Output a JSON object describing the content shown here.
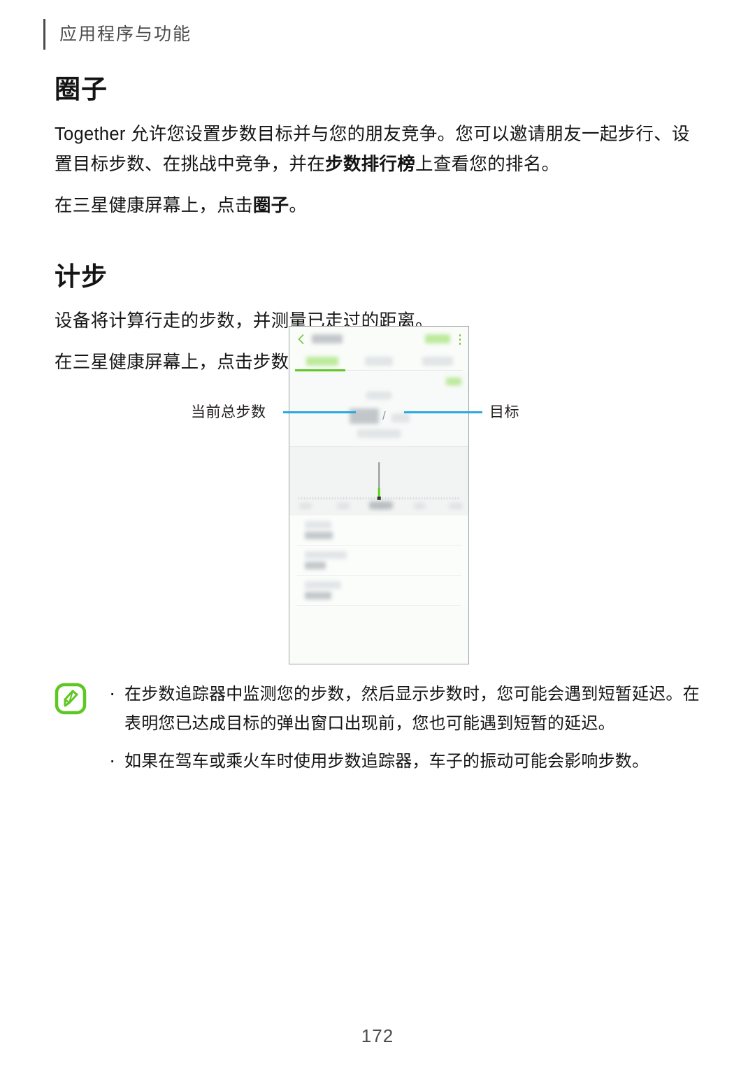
{
  "header": {
    "breadcrumb": "应用程序与功能"
  },
  "sections": [
    {
      "title": "圈子",
      "paragraphs": [
        {
          "parts": [
            {
              "text": "Together 允许您设置步数目标并与您的朋友竞争。您可以邀请朋友一起步行、设置目标步数、在挑战中竞争，并在",
              "bold": false
            },
            {
              "text": "步数排行榜",
              "bold": true
            },
            {
              "text": "上查看您的排名。",
              "bold": false
            }
          ]
        },
        {
          "parts": [
            {
              "text": "在三星健康屏幕上，点击",
              "bold": false
            },
            {
              "text": "圈子",
              "bold": true
            },
            {
              "text": "。",
              "bold": false
            }
          ]
        }
      ]
    },
    {
      "title": "计步",
      "paragraphs": [
        {
          "parts": [
            {
              "text": "设备将计算行走的步数，并测量已走过的距离。",
              "bold": false
            }
          ]
        },
        {
          "parts": [
            {
              "text": "在三星健康屏幕上，点击步数追踪器。",
              "bold": false
            }
          ]
        }
      ]
    }
  ],
  "figure": {
    "callouts": {
      "left_label": "当前总步数",
      "right_label": "目标"
    },
    "phone": {
      "back_icon": "chevron-left-icon",
      "menu_icon": "overflow-menu-icon",
      "app_bar_title": "",
      "app_bar_action": "",
      "tabs": [
        "",
        "",
        ""
      ],
      "hero": {
        "subtitle": "",
        "current_steps": "",
        "separator": "/",
        "goal_steps": "",
        "caption": "",
        "badge": ""
      },
      "chart": {
        "x_labels": [
          "",
          "",
          "",
          "",
          "",
          ""
        ]
      },
      "rows": [
        {
          "title": "",
          "subtitle": ""
        },
        {
          "title": "",
          "subtitle": ""
        },
        {
          "title": "",
          "subtitle": ""
        }
      ]
    }
  },
  "note": {
    "icon": "note-pencil-icon",
    "bullets": [
      "在步数追踪器中监测您的步数，然后显示步数时，您可能会遇到短暂延迟。在表明您已达成目标的弹出窗口出现前，您也可能遇到短暂的延迟。",
      "如果在驾车或乘火车时使用步数追踪器，车子的振动可能会影响步数。"
    ]
  },
  "footer": {
    "page_number": "172"
  },
  "colors": {
    "accent_green": "#5ec722",
    "callout_blue": "#29a9e1",
    "text": "#141414",
    "muted": "#4c4c4c"
  }
}
